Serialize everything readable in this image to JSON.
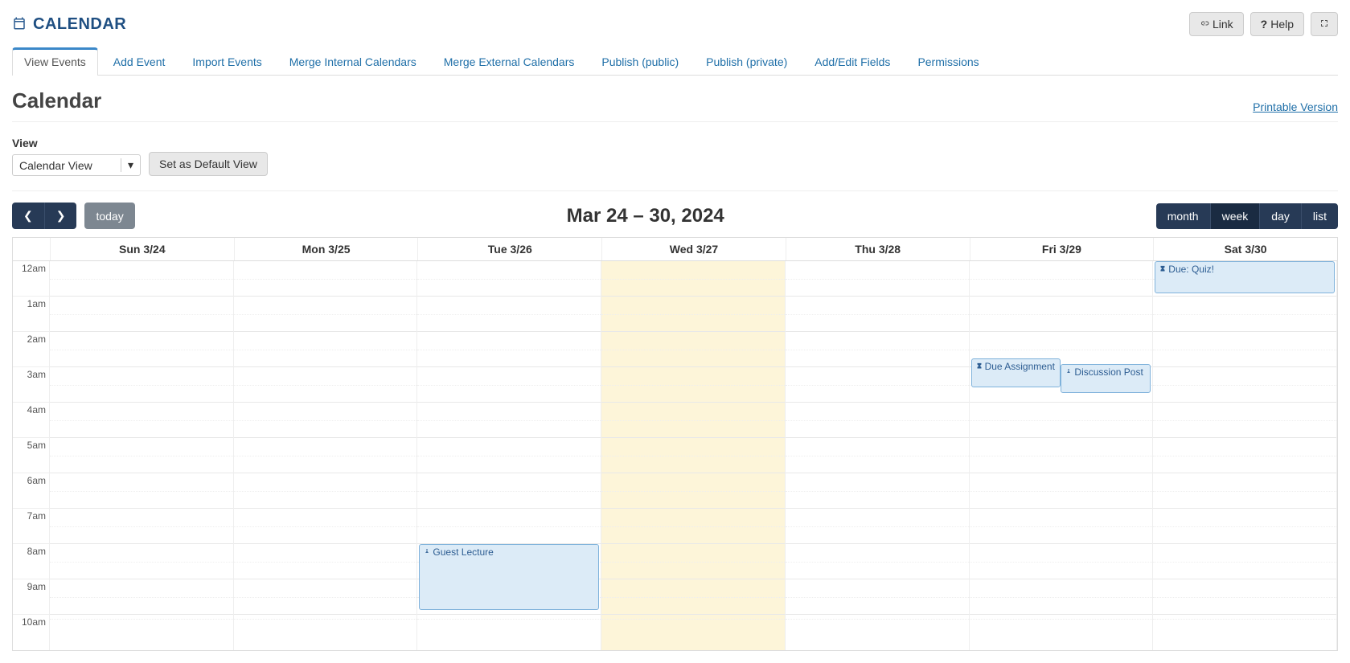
{
  "header": {
    "title": "CALENDAR",
    "link_label": "Link",
    "help_label": "Help"
  },
  "tabs": [
    "View Events",
    "Add Event",
    "Import Events",
    "Merge Internal Calendars",
    "Merge External Calendars",
    "Publish (public)",
    "Publish (private)",
    "Add/Edit Fields",
    "Permissions"
  ],
  "subheader": {
    "title": "Calendar",
    "printable": "Printable Version"
  },
  "view_control": {
    "label": "View",
    "selected": "Calendar View",
    "set_default": "Set as Default View"
  },
  "toolbar": {
    "today": "today",
    "date_range": "Mar 24 – 30, 2024",
    "views": {
      "month": "month",
      "week": "week",
      "day": "day",
      "list": "list"
    }
  },
  "days": [
    "Sun 3/24",
    "Mon 3/25",
    "Tue 3/26",
    "Wed 3/27",
    "Thu 3/28",
    "Fri 3/29",
    "Sat 3/30"
  ],
  "hours": [
    "12am",
    "1am",
    "2am",
    "3am",
    "4am",
    "5am",
    "6am",
    "7am",
    "8am",
    "9am",
    "10am"
  ],
  "events": {
    "guest_lecture": "Guest Lecture",
    "due_assignment": "Due Assignment",
    "discussion_post": "Discussion Post",
    "due_quiz": "Due: Quiz!"
  }
}
